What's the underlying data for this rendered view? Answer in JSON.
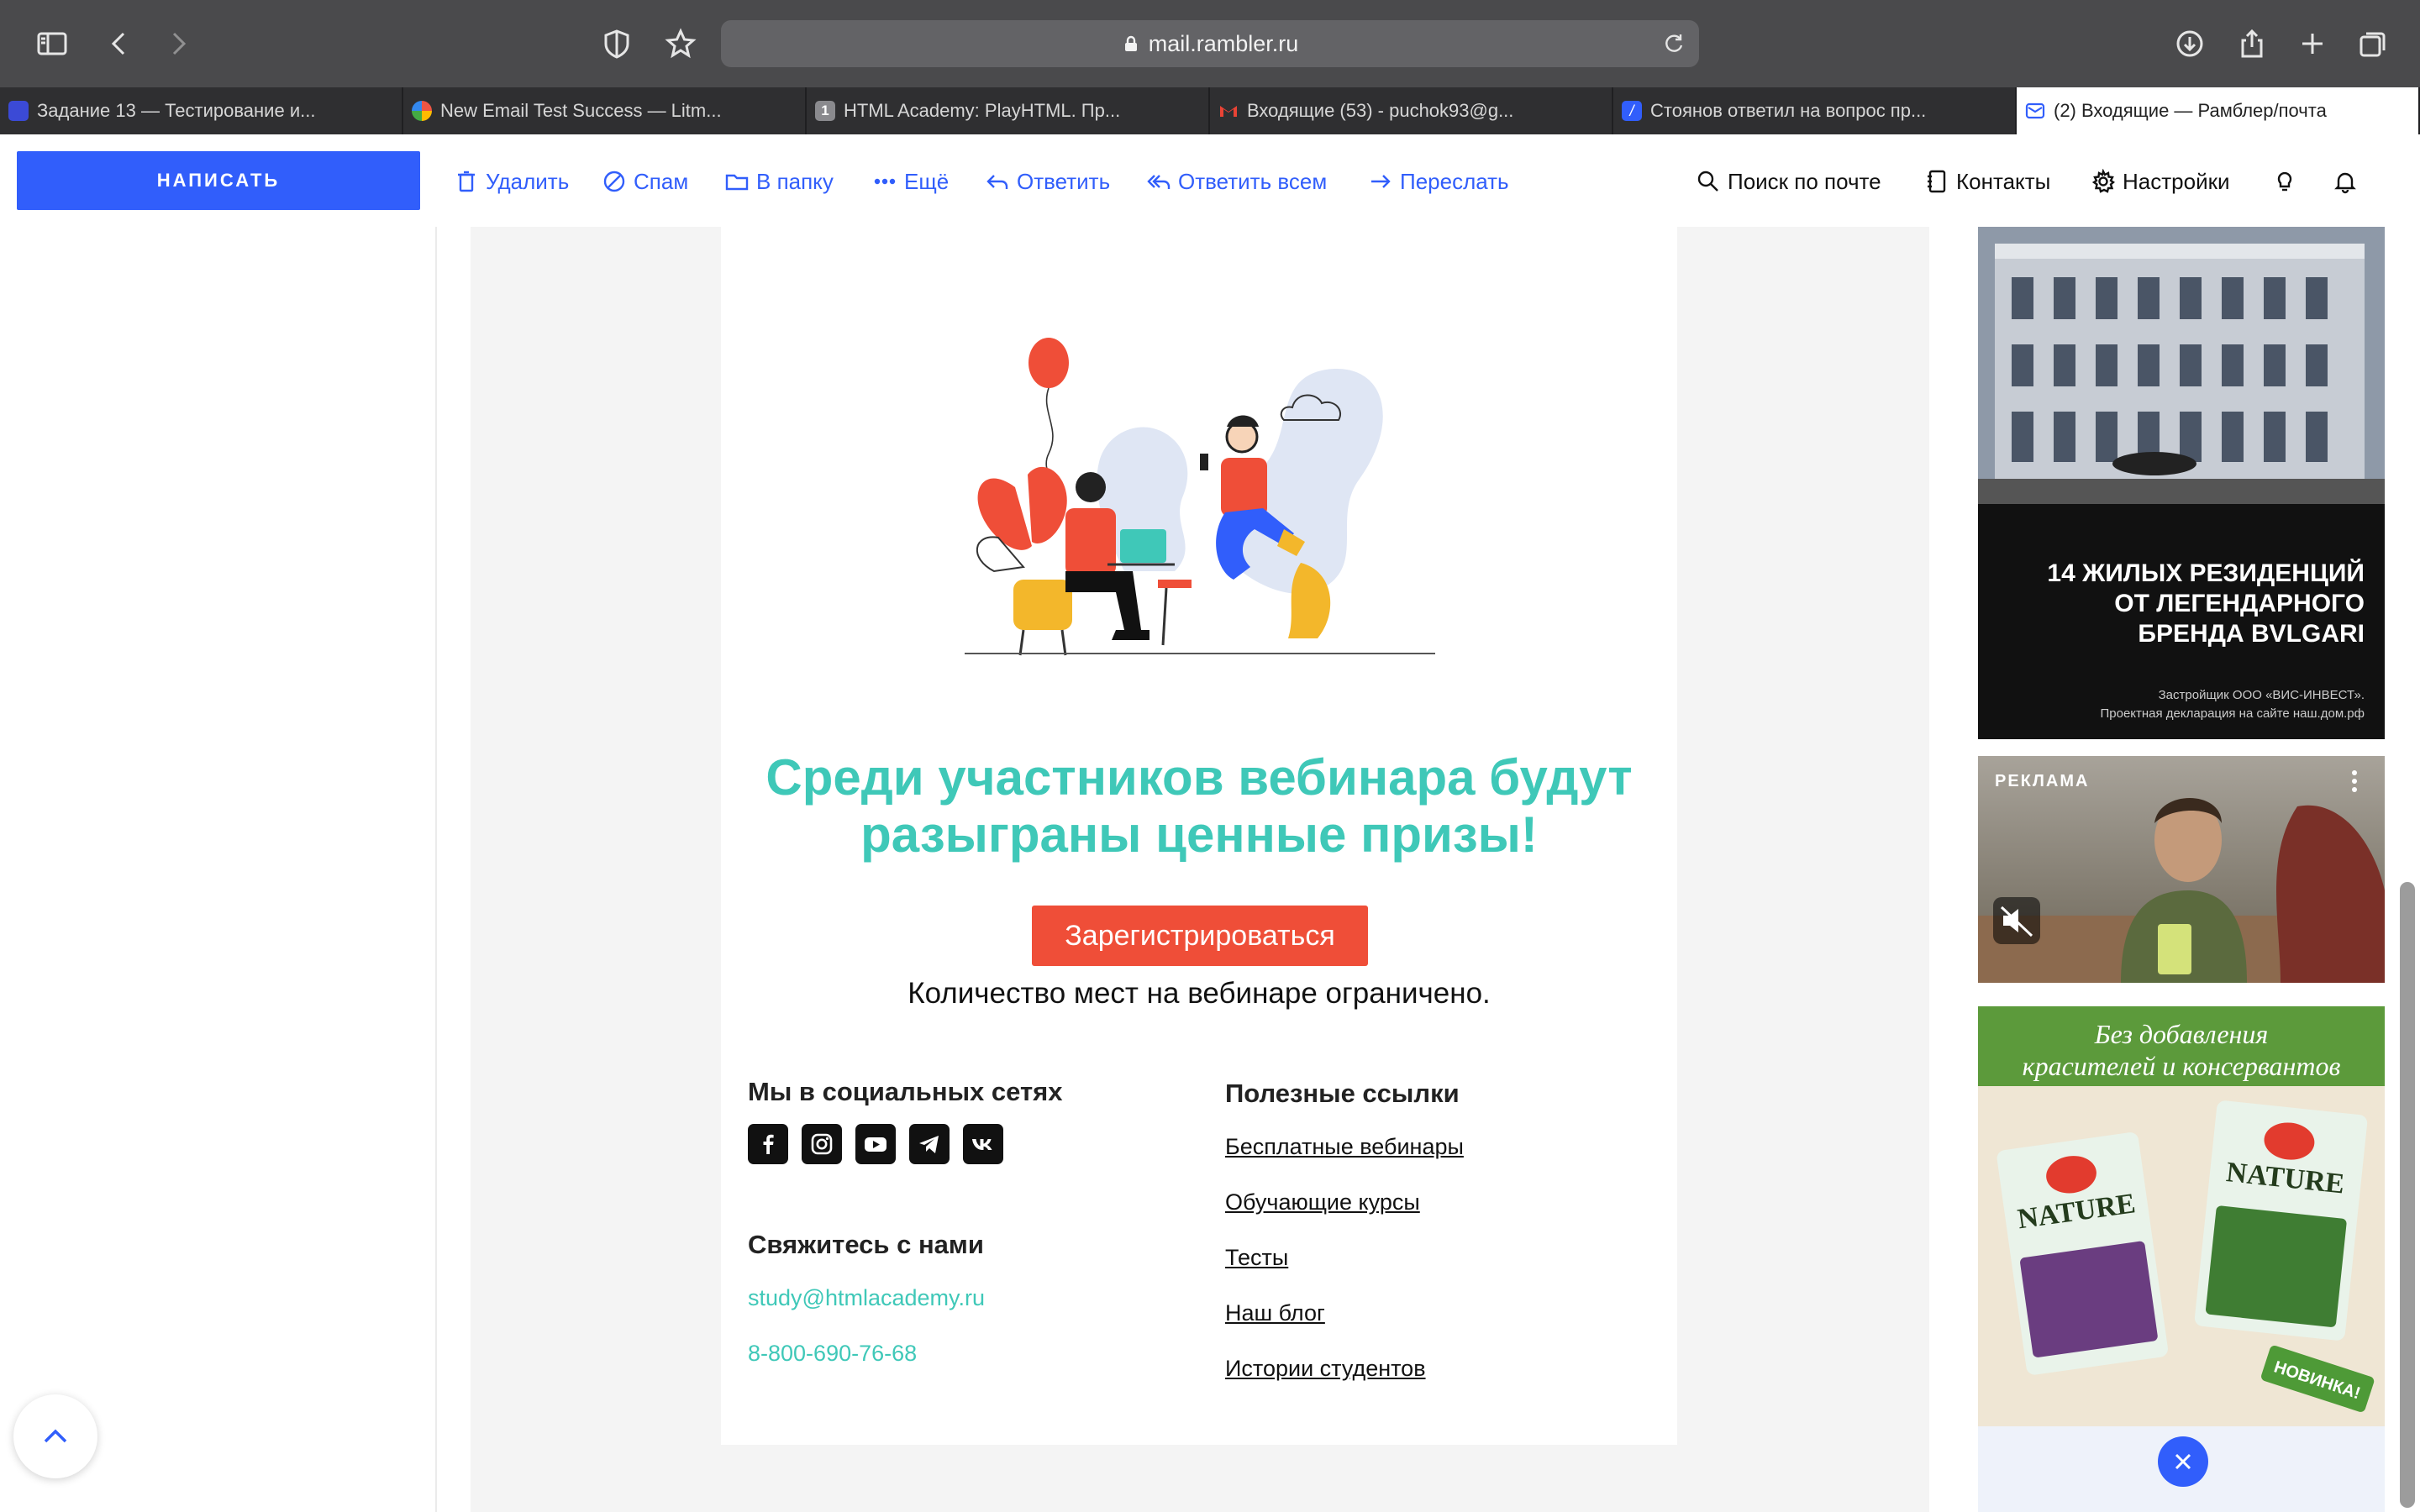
{
  "browser": {
    "url": "mail.rambler.ru",
    "tabs": [
      {
        "label": "Задание 13 — Тестирование и...",
        "fav_color": "#3b4ad6"
      },
      {
        "label": "New Email Test Success — Litm...",
        "fav_color": "#e0a030"
      },
      {
        "label": "HTML Academy: PlayHTML. Пр...",
        "fav_color": "#8a8a8e",
        "fav_text": "1"
      },
      {
        "label": "Входящие (53) - puchok93@g...",
        "fav_color": "#ffffff"
      },
      {
        "label": "Стоянов ответил на вопрос пр...",
        "fav_color": "#315efb"
      },
      {
        "label": "(2) Входящие — Рамблер/почта",
        "fav_color": "#315efb",
        "active": true
      }
    ]
  },
  "mailbar": {
    "compose": "НАПИСАТЬ",
    "delete": "Удалить",
    "spam": "Спам",
    "to_folder": "В папку",
    "more": "Ещё",
    "reply": "Ответить",
    "reply_all": "Ответить всем",
    "forward": "Переслать",
    "search": "Поиск по почте",
    "contacts": "Контакты",
    "settings": "Настройки"
  },
  "email": {
    "heading": "Среди участников вебинара будут разыграны ценные призы!",
    "cta": "Зарегистрироваться",
    "limit": "Количество мест на вебинаре ограничено.",
    "social_heading": "Мы в социальных сетях",
    "contact_heading": "Свяжитесь с нами",
    "email": "study@htmlacademy.ru",
    "phone": "8-800-690-76-68",
    "links_heading": "Полезные ссылки",
    "links": [
      "Бесплатные вебинары",
      "Обучающие курсы",
      "Тесты",
      "Наш блог",
      "Истории студентов"
    ],
    "social_icons": [
      "facebook-icon",
      "instagram-icon",
      "youtube-icon",
      "telegram-icon",
      "vk-icon"
    ]
  },
  "ads": {
    "ad1_lines": [
      "14 ЖИЛЫХ РЕЗИДЕНЦИЙ",
      "ОТ ЛЕГЕНДАРНОГО",
      "БРЕНДА BVLGARI"
    ],
    "ad1_fine1": "Застройщик ООО «ВИС-ИНВЕСТ».",
    "ad1_fine2": "Проектная декларация на сайте наш.дом.рф",
    "ad2_label": "РЕКЛАМА",
    "ad3_top1": "Без добавления",
    "ad3_top2": "красителей и консервантов",
    "ad3_brand": "NATURE",
    "ad3_badge": "НОВИНКА!"
  },
  "colors": {
    "accent": "#315efb",
    "teal": "#3fc8b8",
    "cta": "#ef4e38"
  }
}
